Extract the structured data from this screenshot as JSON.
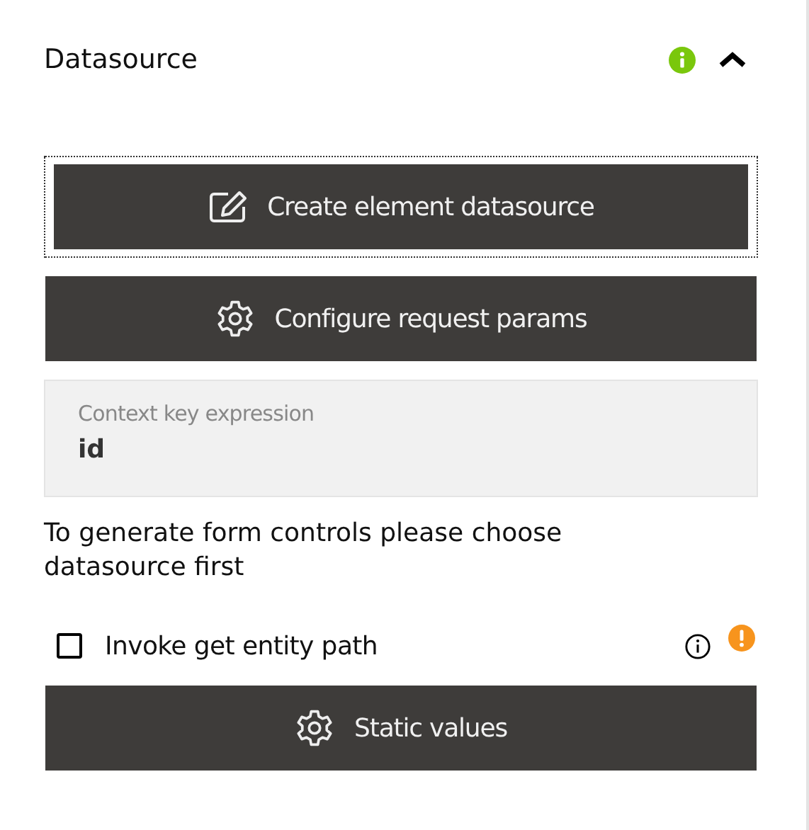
{
  "section": {
    "title": "Datasource",
    "expanded": true
  },
  "buttons": [
    {
      "label": "Create element datasource",
      "kind": "edit",
      "focused": true
    },
    {
      "label": "Configure request params",
      "kind": "gear",
      "focused": false
    }
  ],
  "context_field": {
    "label": "Context key expression",
    "value": "id"
  },
  "hint": "To generate form controls please choose datasource first",
  "checkbox": {
    "label": "Invoke get entity path",
    "checked": false
  },
  "bottom_button": {
    "label": "Static values",
    "kind": "gear",
    "focused": false
  }
}
